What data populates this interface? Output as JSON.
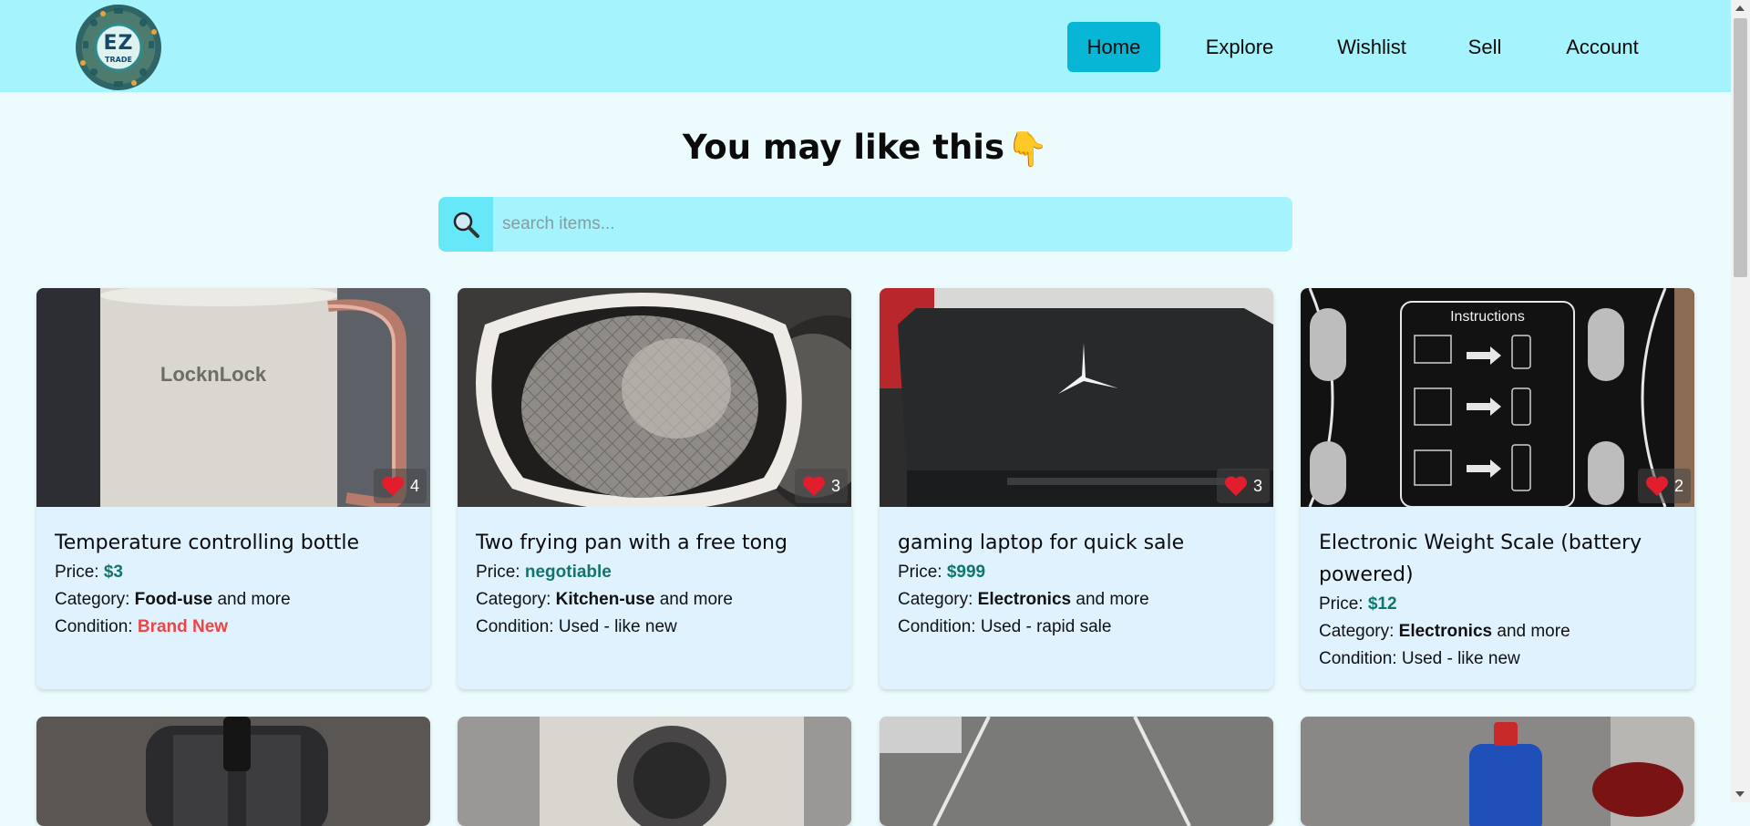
{
  "app": {
    "logo_text": "EZ",
    "logo_sub": "TRADE"
  },
  "nav": {
    "items": [
      {
        "label": "Home",
        "active": true
      },
      {
        "label": "Explore"
      },
      {
        "label": "Wishlist"
      },
      {
        "label": "Sell"
      },
      {
        "label": "Account"
      }
    ]
  },
  "main": {
    "heading": "You may like this",
    "heading_emoji": "👇",
    "search": {
      "placeholder": "search items...",
      "value": ""
    }
  },
  "listings": [
    {
      "title": "Temperature controlling bottle",
      "price_label": "Price:",
      "price": "$3",
      "category_label": "Category:",
      "category": "Food-use",
      "category_suffix": "and more",
      "condition_label": "Condition:",
      "condition": "Brand New",
      "likes": "4",
      "image": "mug-photo"
    },
    {
      "title": "Two frying pan with a free tong",
      "price_label": "Price:",
      "price": "negotiable",
      "category_label": "Category:",
      "category": "Kitchen-use",
      "category_suffix": "and more",
      "condition_label": "Condition:",
      "condition": "Used - like new",
      "likes": "3",
      "image": "frying-pan-photo"
    },
    {
      "title": "gaming laptop for quick sale",
      "price_label": "Price:",
      "price": "$999",
      "category_label": "Category:",
      "category": "Electronics",
      "category_suffix": "and more",
      "condition_label": "Condition:",
      "condition": "Used - rapid sale",
      "likes": "3",
      "image": "laptop-photo"
    },
    {
      "title": "Electronic Weight Scale (battery powered)",
      "price_label": "Price:",
      "price": "$12",
      "category_label": "Category:",
      "category": "Electronics",
      "category_suffix": "and more",
      "condition_label": "Condition:",
      "condition": "Used - like new",
      "likes": "2",
      "image": "weight-scale-photo",
      "scale_text": "Instructions"
    }
  ],
  "colors": {
    "navbar_bg": "#a5f3fc",
    "active_nav": "#06b6d4",
    "price": "#0f766e",
    "brand_new": "#ef4444",
    "card_bg": "#e0f2fe",
    "page_bg": "#ecfbfe"
  }
}
